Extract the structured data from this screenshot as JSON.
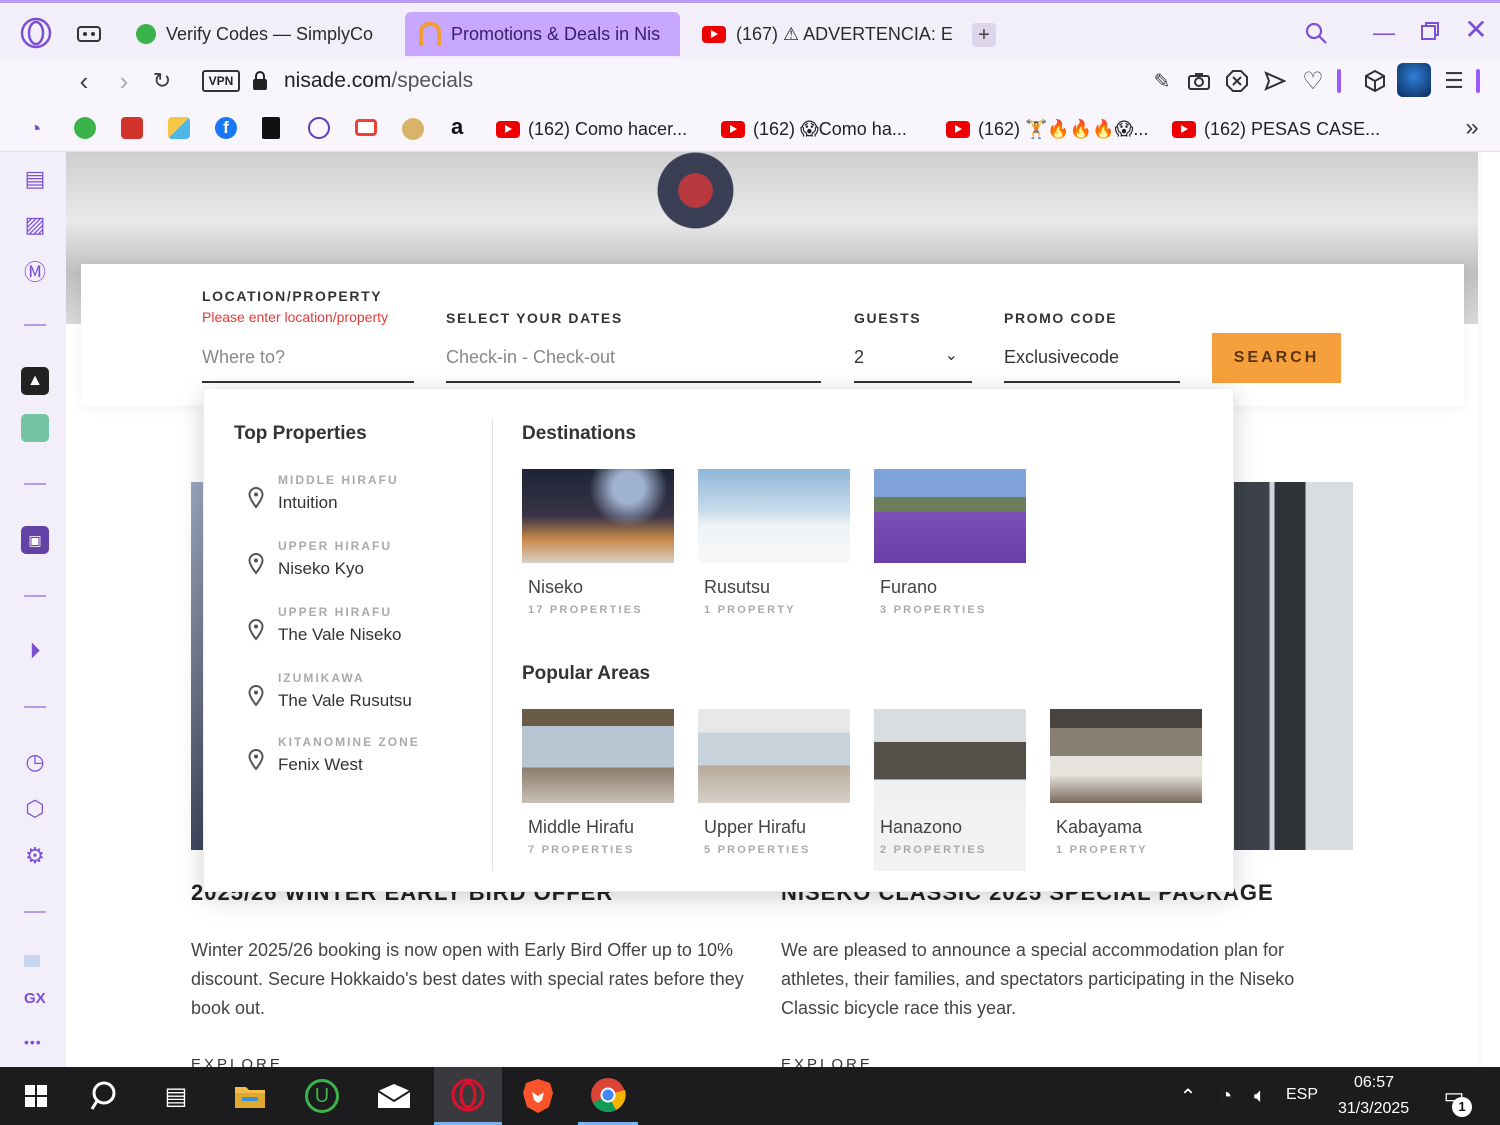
{
  "tabs": [
    {
      "label": "Verify Codes — SimplyCo"
    },
    {
      "label": "Promotions & Deals in Nis"
    },
    {
      "label": "(167) ⚠ ADVERTENCIA: E"
    }
  ],
  "address": {
    "vpn": "VPN",
    "url_host": "nisade.com",
    "url_path": "/specials"
  },
  "bookmarks": [
    {
      "label": "(162) Como hacer..."
    },
    {
      "label": "(162) 😱Como ha..."
    },
    {
      "label": "(162) 🏋🔥🔥🔥😱..."
    },
    {
      "label": "(162) PESAS CASE..."
    }
  ],
  "sidebar": {
    "gx": "GX",
    "more": "•••"
  },
  "search": {
    "location_label": "LOCATION/PROPERTY",
    "location_error": "Please enter location/property",
    "location_placeholder": "Where to?",
    "dates_label": "SELECT YOUR DATES",
    "dates_placeholder": "Check-in - Check-out",
    "guests_label": "GUESTS",
    "guests_value": "2",
    "promo_label": "PROMO CODE",
    "promo_value": "Exclusivecode",
    "search_button": "SEARCH"
  },
  "dropdown": {
    "top_title": "Top Properties",
    "properties": [
      {
        "area": "MIDDLE HIRAFU",
        "name": "Intuition"
      },
      {
        "area": "UPPER HIRAFU",
        "name": "Niseko Kyo"
      },
      {
        "area": "UPPER HIRAFU",
        "name": "The Vale Niseko"
      },
      {
        "area": "IZUMIKAWA",
        "name": "The Vale Rusutsu"
      },
      {
        "area": "KITANOMINE ZONE",
        "name": "Fenix West"
      }
    ],
    "dest_title": "Destinations",
    "destinations": [
      {
        "name": "Niseko",
        "count": "17 PROPERTIES"
      },
      {
        "name": "Rusutsu",
        "count": "1 PROPERTY"
      },
      {
        "name": "Furano",
        "count": "3 PROPERTIES"
      }
    ],
    "areas_title": "Popular Areas",
    "areas": [
      {
        "name": "Middle Hirafu",
        "count": "7 PROPERTIES"
      },
      {
        "name": "Upper Hirafu",
        "count": "5 PROPERTIES"
      },
      {
        "name": "Hanazono",
        "count": "2 PROPERTIES"
      },
      {
        "name": "Kabayama",
        "count": "1 PROPERTY"
      }
    ]
  },
  "offers": [
    {
      "title": "2025/26 WINTER EARLY BIRD OFFER",
      "text": "Winter 2025/26 booking is now open with Early Bird Offer up to 10% discount. Secure Hokkaido's best dates with special rates before they book out.",
      "link": "EXPLORE"
    },
    {
      "title": "NISEKO CLASSIC 2025 SPECIAL PACKAGE",
      "text": "We are pleased to announce a special accommodation plan for athletes, their families, and spectators participating in the Niseko Classic bicycle race this year.",
      "link": "EXPLORE"
    }
  ],
  "taskbar": {
    "lang": "ESP",
    "time": "06:57",
    "date": "31/3/2025",
    "notif_count": "1"
  },
  "colors": {
    "accent": "#c7a7ff",
    "search_button": "#f6a03d",
    "error": "#e53935",
    "opera_red": "#e0102d"
  }
}
